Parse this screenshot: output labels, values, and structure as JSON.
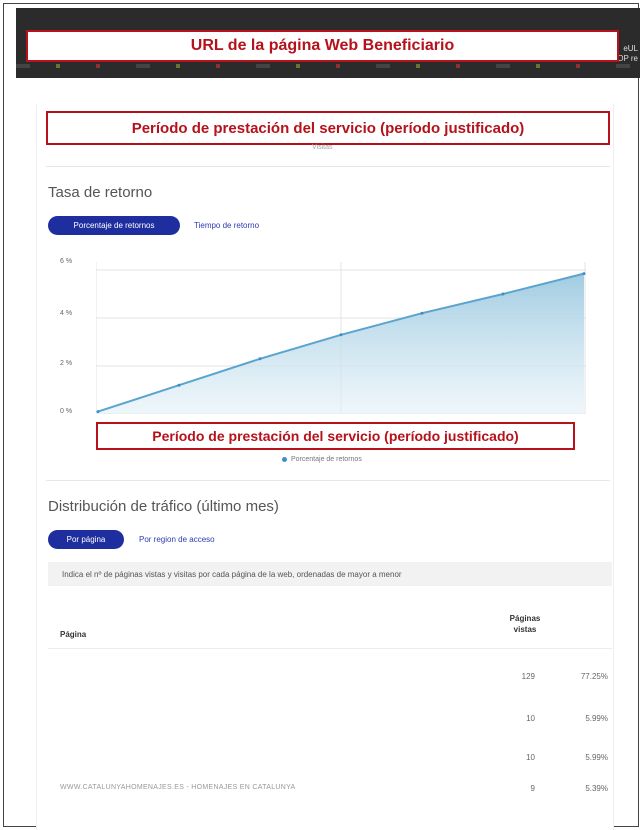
{
  "browser": {
    "url_annotation": "URL de la página Web Beneficiario",
    "right_text_1": "eUL",
    "right_text_2": "OP re"
  },
  "annotations": {
    "period_label": "Período de prestación del servicio (período justificado)"
  },
  "top_legend_fragment": "Visitas",
  "return_rate": {
    "title": "Tasa de retorno",
    "tabs": [
      {
        "label": "Porcentaje de retornos",
        "active": true
      },
      {
        "label": "Tiempo de retorno",
        "active": false
      }
    ],
    "legend": "Porcentaje de retornos"
  },
  "chart_data": {
    "type": "area",
    "ylabel": "",
    "ylim": [
      0,
      6
    ],
    "y_ticks": [
      "6 %",
      "4 %",
      "2 %",
      "0 %"
    ],
    "series": [
      {
        "values": [
          0.1,
          1.2,
          2.3,
          3.3,
          4.2,
          5.0,
          5.85
        ]
      }
    ],
    "grid": true,
    "color": "#3c8fc9"
  },
  "traffic": {
    "title": "Distribución de tráfico (último mes)",
    "tabs": [
      {
        "label": "Por página",
        "active": true
      },
      {
        "label": "Por region de acceso",
        "active": false
      }
    ],
    "info": "Indica el nº de páginas vistas y visitas por cada página de la web, ordenadas de mayor a menor",
    "columns": {
      "page": "Página",
      "views": "Páginas vistas"
    },
    "rows": [
      {
        "page": "",
        "views": "129",
        "pct": "77.25%"
      },
      {
        "page": "",
        "views": "10",
        "pct": "5.99%"
      },
      {
        "page": "",
        "views": "10",
        "pct": "5.99%"
      },
      {
        "page": "WWW.CATALUNYAHOMENAJES.ES - HOMENAJES EN CATALUNYA",
        "views": "9",
        "pct": "5.39%"
      }
    ]
  }
}
